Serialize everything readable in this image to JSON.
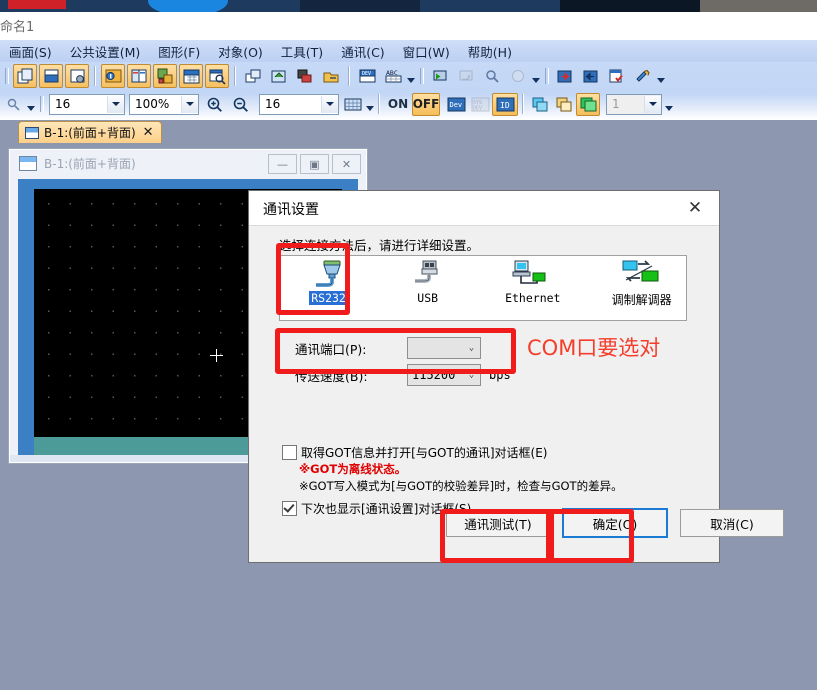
{
  "os_titlebar": {
    "document_name": "命名1"
  },
  "menubar": {
    "items": [
      {
        "label": "画面(S)",
        "name": "menu-screen"
      },
      {
        "label": "公共设置(M)",
        "name": "menu-common-settings"
      },
      {
        "label": "图形(F)",
        "name": "menu-figure"
      },
      {
        "label": "对象(O)",
        "name": "menu-object"
      },
      {
        "label": "工具(T)",
        "name": "menu-tools"
      },
      {
        "label": "通讯(C)",
        "name": "menu-communication"
      },
      {
        "label": "窗口(W)",
        "name": "menu-window"
      },
      {
        "label": "帮助(H)",
        "name": "menu-help"
      }
    ]
  },
  "toolbar2": {
    "font_size": "16",
    "zoom_level": "100%",
    "grid_size": "16",
    "on_label": "ON",
    "off_label": "OFF",
    "dev_label": "Dev",
    "sysdev_label": "SYS DEV",
    "id_label": "ID",
    "layer_value": "1"
  },
  "tab": {
    "label": "B-1:(前面+背面)",
    "close": "✕"
  },
  "mdi_window": {
    "title": "B-1:(前面+背面)",
    "minimize": "—",
    "restore": "▣",
    "close": "✕"
  },
  "dialog": {
    "title": "通讯设置",
    "close_icon": "✕",
    "hint": "选择连接方法后，请进行详细设置。",
    "methods": [
      {
        "name": "RS232",
        "type": "mono",
        "selected": true
      },
      {
        "name": "USB",
        "type": "mono",
        "selected": false
      },
      {
        "name": "Ethernet",
        "type": "mono",
        "selected": false
      },
      {
        "name": "调制解调器",
        "type": "cn",
        "selected": false
      }
    ],
    "port_label": "通讯端口(P):",
    "port_value": "",
    "speed_label": "传送速度(B):",
    "speed_value": "115200",
    "speed_unit": "bps",
    "checkbox_got": {
      "checked": false,
      "label": "取得GOT信息并打开[与GOT的通讯]对话框(E)",
      "note_red": "※GOT为离线状态。",
      "note_black": "※GOT写入模式为[与GOT的校验差异]时，检查与GOT的差异。"
    },
    "checkbox_show_next": {
      "checked": true,
      "label": "下次也显示[通讯设置]对话框(S)"
    },
    "buttons": [
      {
        "label": "通讯测试(T)",
        "name": "comm-test-button",
        "focused": false
      },
      {
        "label": "确定(O)",
        "name": "ok-button",
        "focused": true
      },
      {
        "label": "取消(C)",
        "name": "cancel-button",
        "focused": false
      }
    ]
  },
  "annotations": {
    "com_note": "COM口要选对",
    "accent_red": "#f01b1b"
  }
}
